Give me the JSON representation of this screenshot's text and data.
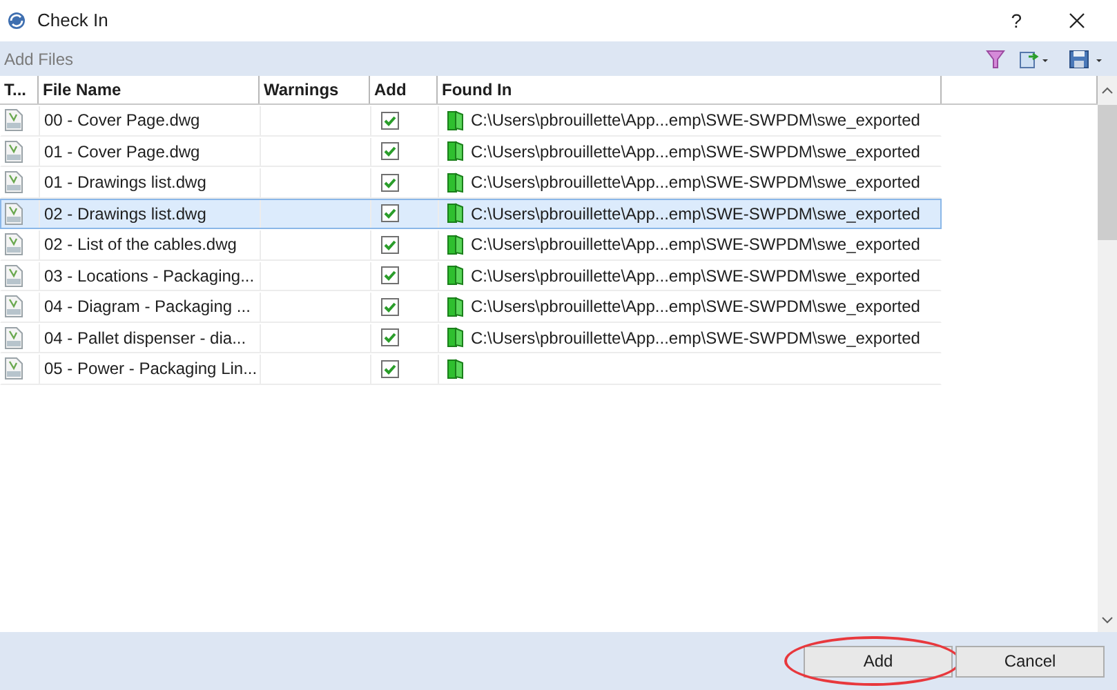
{
  "window": {
    "title": "Check In",
    "help": "?"
  },
  "toolbar": {
    "label": "Add Files"
  },
  "table": {
    "columns": [
      "T...",
      "File Name",
      "Warnings",
      "Add",
      "Found In"
    ],
    "rows": [
      {
        "file_name": "00 - Cover Page.dwg",
        "add": true,
        "found_in": "C:\\Users\\pbrouillette\\App...emp\\SWE-SWPDM\\swe_exported",
        "selected": false
      },
      {
        "file_name": "01 - Cover Page.dwg",
        "add": true,
        "found_in": "C:\\Users\\pbrouillette\\App...emp\\SWE-SWPDM\\swe_exported",
        "selected": false
      },
      {
        "file_name": "01 - Drawings list.dwg",
        "add": true,
        "found_in": "C:\\Users\\pbrouillette\\App...emp\\SWE-SWPDM\\swe_exported",
        "selected": false
      },
      {
        "file_name": "02 - Drawings list.dwg",
        "add": true,
        "found_in": "C:\\Users\\pbrouillette\\App...emp\\SWE-SWPDM\\swe_exported",
        "selected": true
      },
      {
        "file_name": "02 - List of the cables.dwg",
        "add": true,
        "found_in": "C:\\Users\\pbrouillette\\App...emp\\SWE-SWPDM\\swe_exported",
        "selected": false
      },
      {
        "file_name": "03 - Locations - Packaging...",
        "add": true,
        "found_in": "C:\\Users\\pbrouillette\\App...emp\\SWE-SWPDM\\swe_exported",
        "selected": false
      },
      {
        "file_name": "04 - Diagram - Packaging ...",
        "add": true,
        "found_in": "C:\\Users\\pbrouillette\\App...emp\\SWE-SWPDM\\swe_exported",
        "selected": false
      },
      {
        "file_name": "04 - Pallet dispenser - dia...",
        "add": true,
        "found_in": "C:\\Users\\pbrouillette\\App...emp\\SWE-SWPDM\\swe_exported",
        "selected": false
      },
      {
        "file_name": "05 - Power - Packaging Lin...",
        "add": true,
        "selected": false
      }
    ]
  },
  "buttons": [
    {
      "label": "Add",
      "highlighted": true
    },
    {
      "label": "Cancel",
      "highlighted": false
    }
  ]
}
